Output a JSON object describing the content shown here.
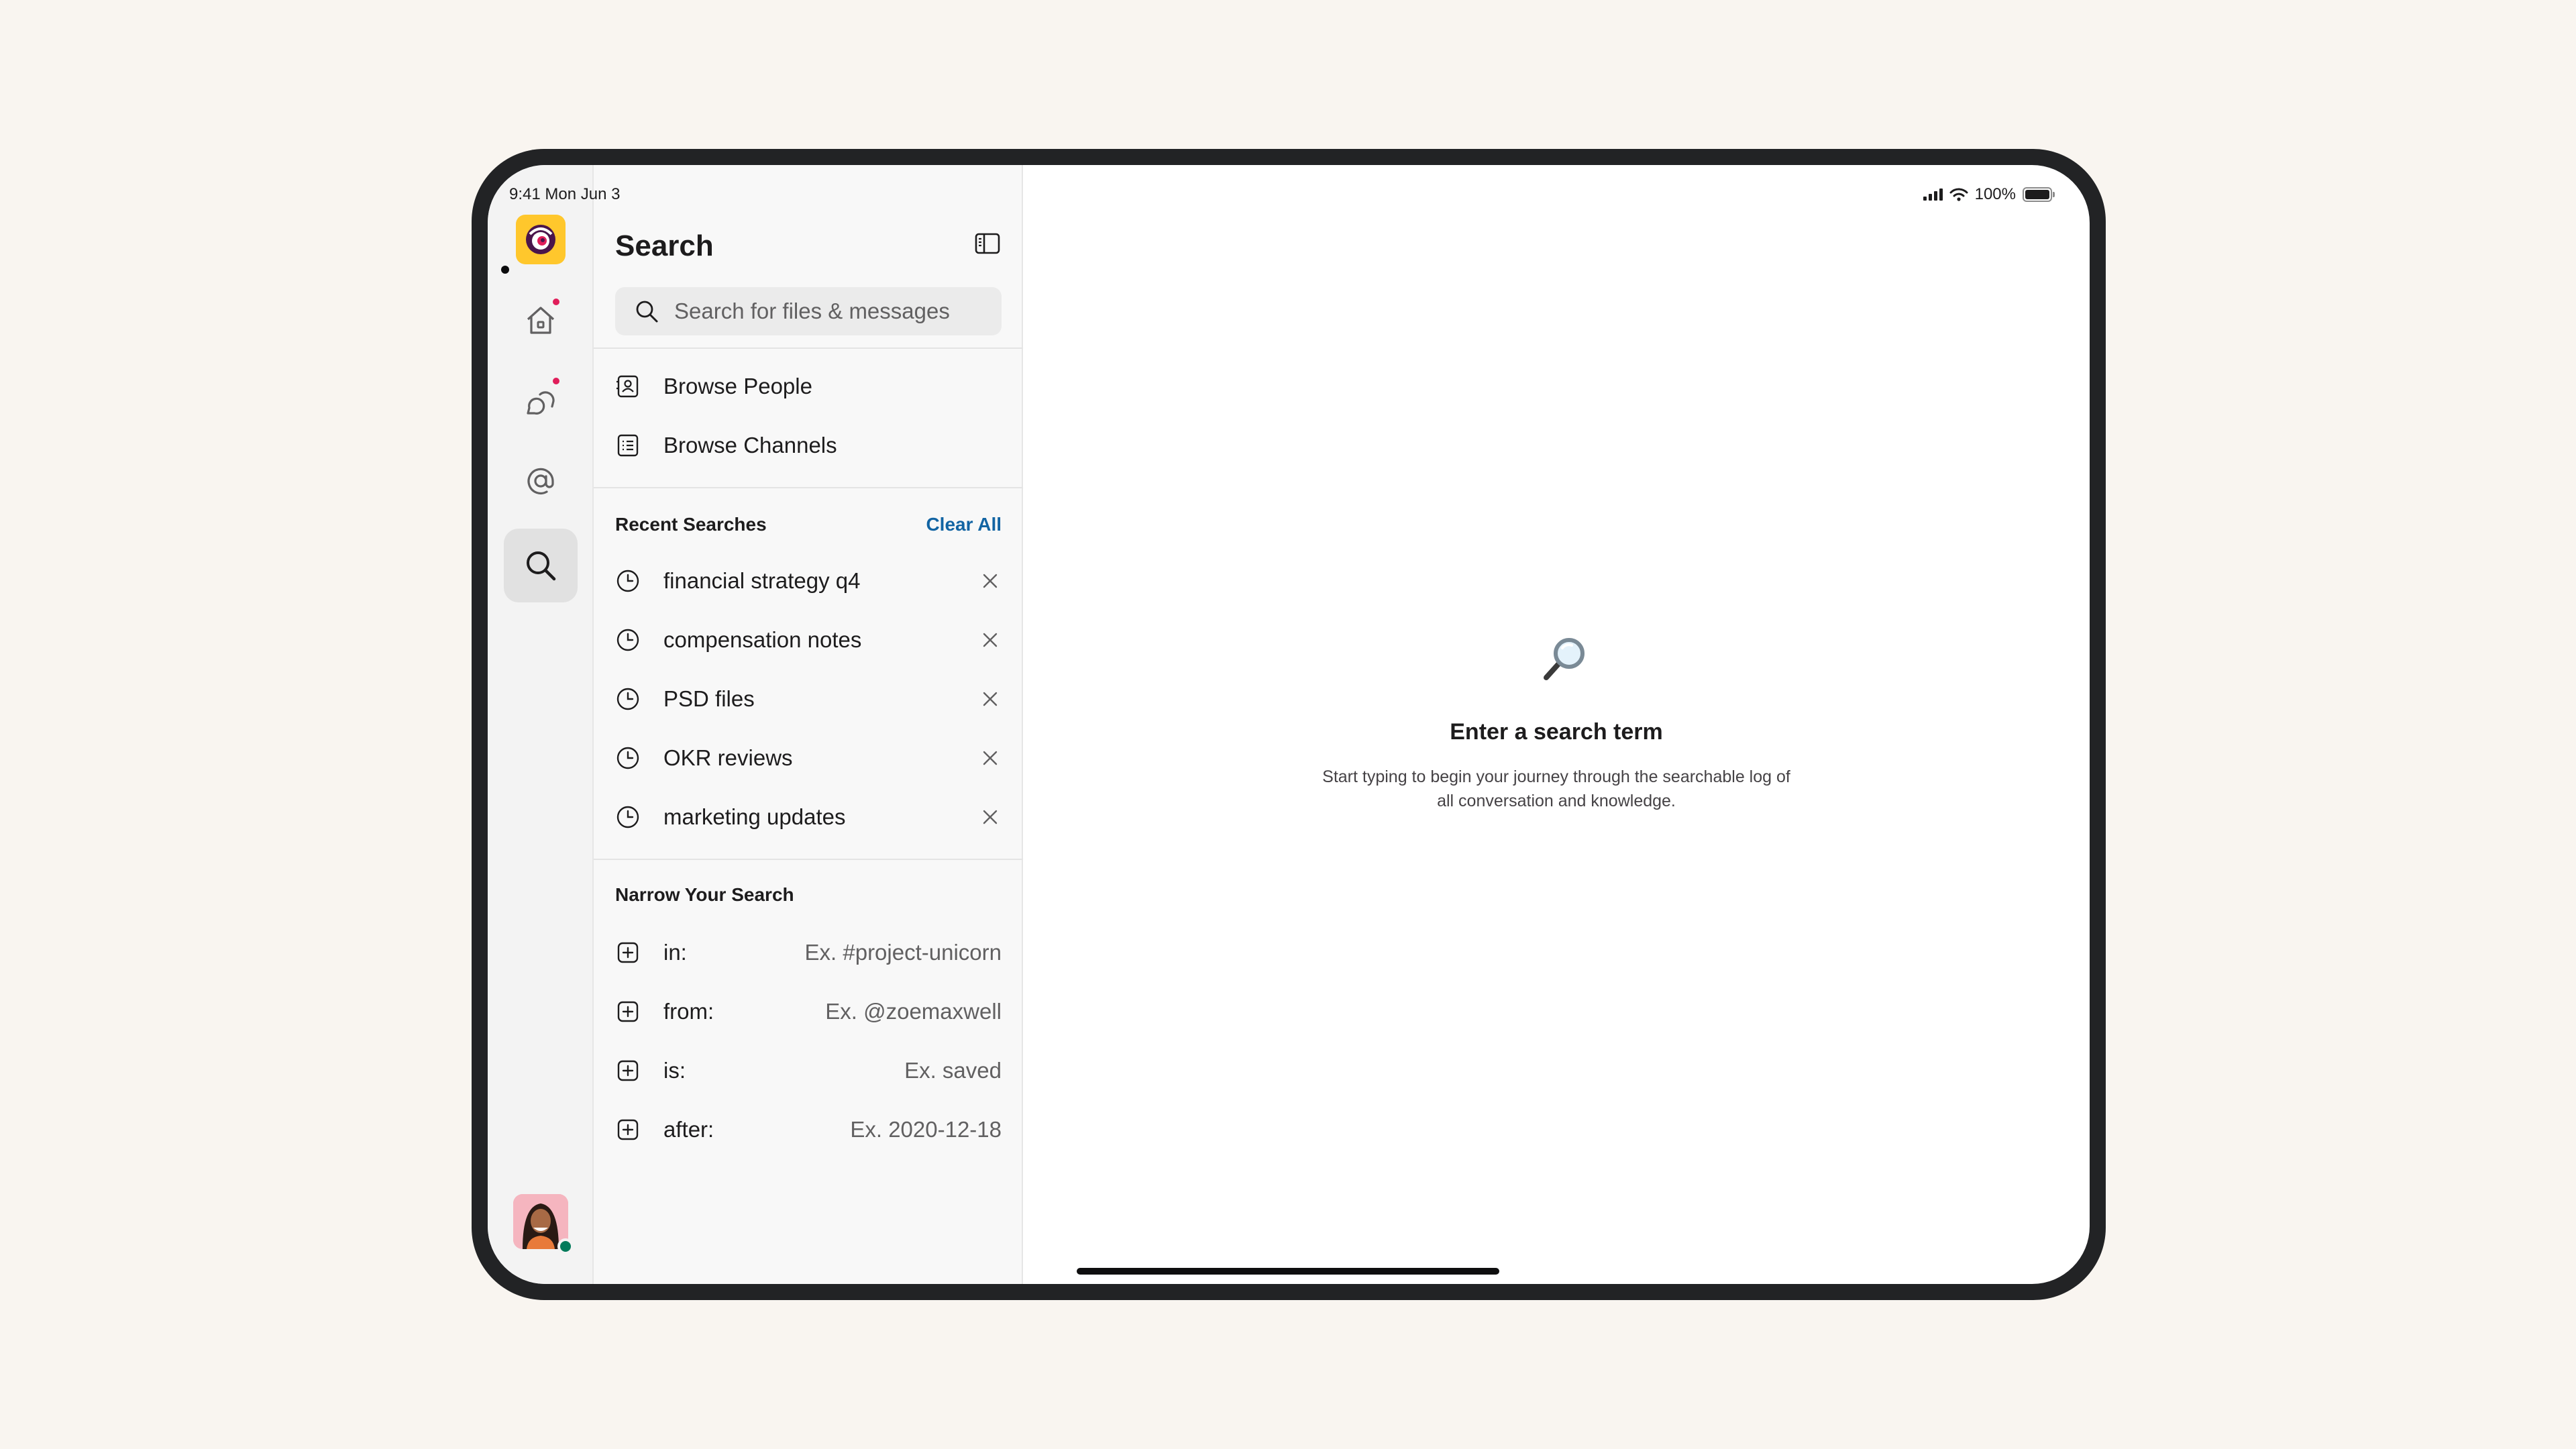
{
  "status_bar": {
    "time": "9:41  Mon Jun 3",
    "battery": "100%"
  },
  "rail": {
    "items": [
      {
        "name": "workspace",
        "icon": "workspace-logo-icon"
      },
      {
        "name": "home",
        "icon": "home-icon",
        "badge": true
      },
      {
        "name": "dms",
        "icon": "messages-icon",
        "badge": true
      },
      {
        "name": "activity",
        "icon": "mention-icon"
      },
      {
        "name": "search",
        "icon": "search-icon",
        "active": true
      }
    ]
  },
  "panel": {
    "title": "Search",
    "search_placeholder": "Search for files & messages",
    "browse": [
      {
        "label": "Browse People",
        "icon": "contact-card-icon"
      },
      {
        "label": "Browse Channels",
        "icon": "channel-list-icon"
      }
    ],
    "recent": {
      "heading": "Recent Searches",
      "clear_label": "Clear All",
      "items": [
        "financial strategy q4",
        "compensation notes",
        "PSD files",
        "OKR reviews",
        "marketing updates"
      ]
    },
    "narrow": {
      "heading": "Narrow Your Search",
      "items": [
        {
          "label": "in:",
          "hint": "Ex. #project-unicorn"
        },
        {
          "label": "from:",
          "hint": "Ex. @zoemaxwell"
        },
        {
          "label": "is:",
          "hint": "Ex. saved"
        },
        {
          "label": "after:",
          "hint": "Ex. 2020-12-18"
        }
      ]
    }
  },
  "empty_state": {
    "title": "Enter a search term",
    "subtitle": "Start typing to begin your journey through the searchable log of all conversation and knowledge."
  },
  "colors": {
    "accent": "#1264a3",
    "badge": "#e01e5a",
    "presence": "#007a5a",
    "workspace": "#ffc72c"
  }
}
